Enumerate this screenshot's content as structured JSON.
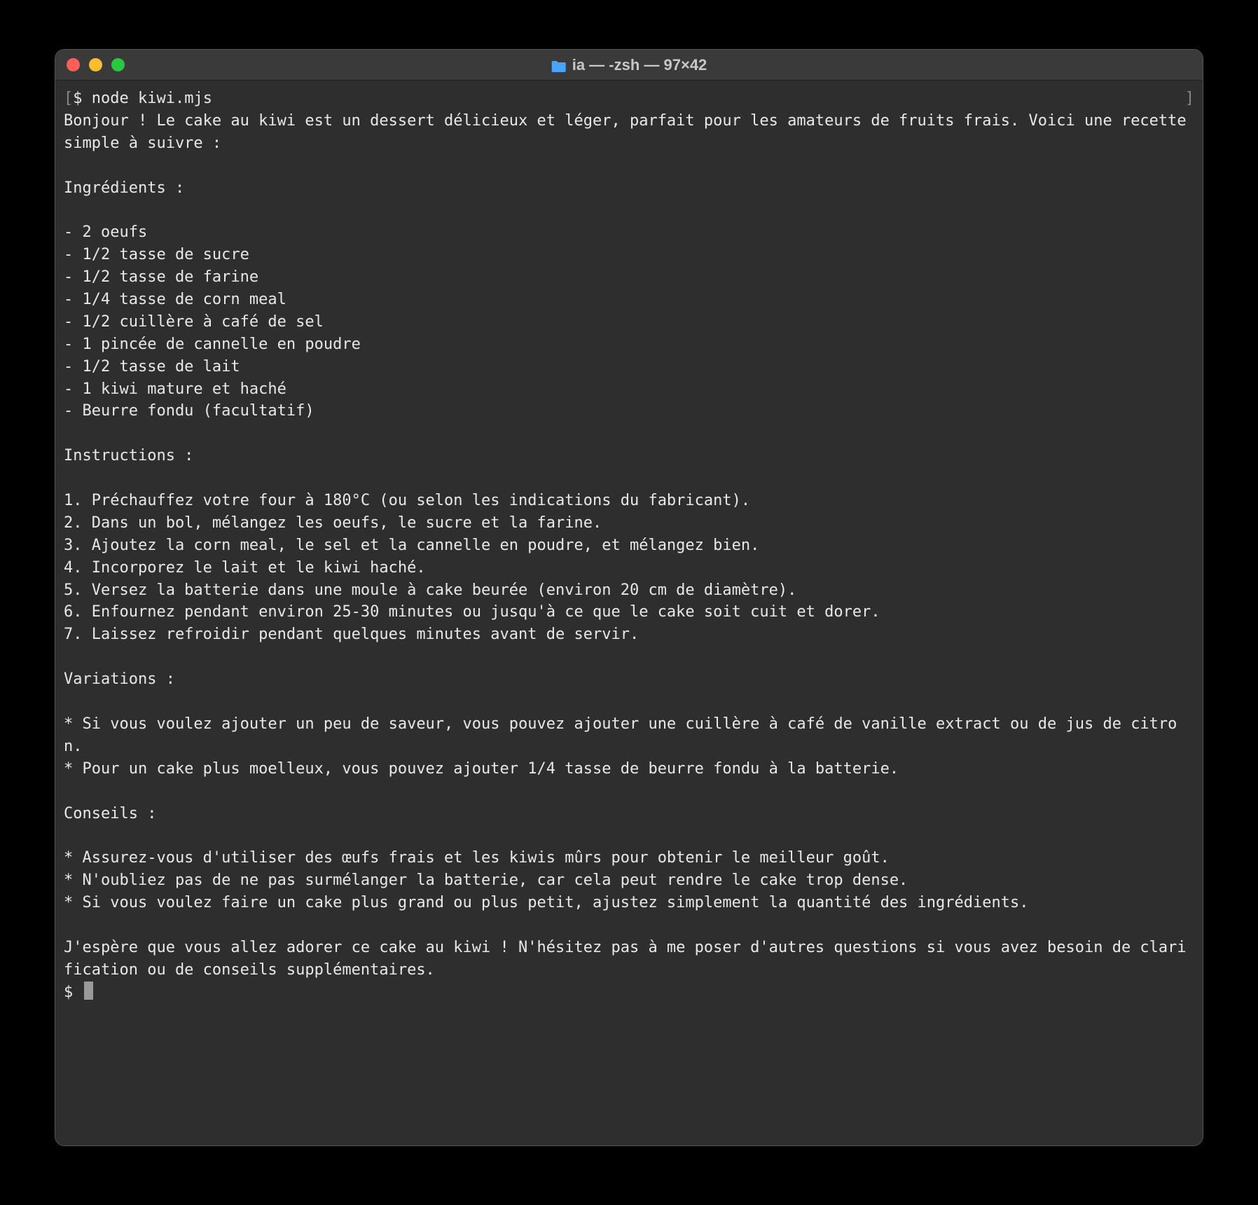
{
  "window": {
    "title": "ia — -zsh — 97×42",
    "folder_icon": "folder-icon"
  },
  "terminal": {
    "prompt1_bracket_open": "[",
    "prompt1": "$ ",
    "command": "node kiwi.mjs",
    "prompt1_bracket_close": "]",
    "lines": [
      "Bonjour ! Le cake au kiwi est un dessert délicieux et léger, parfait pour les amateurs de fruits frais. Voici une recette simple à suivre :",
      "",
      "Ingrédients :",
      "",
      "- 2 oeufs",
      "- 1/2 tasse de sucre",
      "- 1/2 tasse de farine",
      "- 1/4 tasse de corn meal",
      "- 1/2 cuillère à café de sel",
      "- 1 pincée de cannelle en poudre",
      "- 1/2 tasse de lait",
      "- 1 kiwi mature et haché",
      "- Beurre fondu (facultatif)",
      "",
      "Instructions :",
      "",
      "1. Préchauffez votre four à 180°C (ou selon les indications du fabricant).",
      "2. Dans un bol, mélangez les oeufs, le sucre et la farine.",
      "3. Ajoutez la corn meal, le sel et la cannelle en poudre, et mélangez bien.",
      "4. Incorporez le lait et le kiwi haché.",
      "5. Versez la batterie dans une moule à cake beurée (environ 20 cm de diamètre).",
      "6. Enfournez pendant environ 25-30 minutes ou jusqu'à ce que le cake soit cuit et dorer.",
      "7. Laissez refroidir pendant quelques minutes avant de servir.",
      "",
      "Variations :",
      "",
      "* Si vous voulez ajouter un peu de saveur, vous pouvez ajouter une cuillère à café de vanille extract ou de jus de citron.",
      "* Pour un cake plus moelleux, vous pouvez ajouter 1/4 tasse de beurre fondu à la batterie.",
      "",
      "Conseils :",
      "",
      "* Assurez-vous d'utiliser des œufs frais et les kiwis mûrs pour obtenir le meilleur goût.",
      "* N'oubliez pas de ne pas surmélanger la batterie, car cela peut rendre le cake trop dense.",
      "* Si vous voulez faire un cake plus grand ou plus petit, ajustez simplement la quantité des ingrédients.",
      "",
      "J'espère que vous allez adorer ce cake au kiwi ! N'hésitez pas à me poser d'autres questions si vous avez besoin de clarification ou de conseils supplémentaires."
    ],
    "prompt2": "$ "
  }
}
